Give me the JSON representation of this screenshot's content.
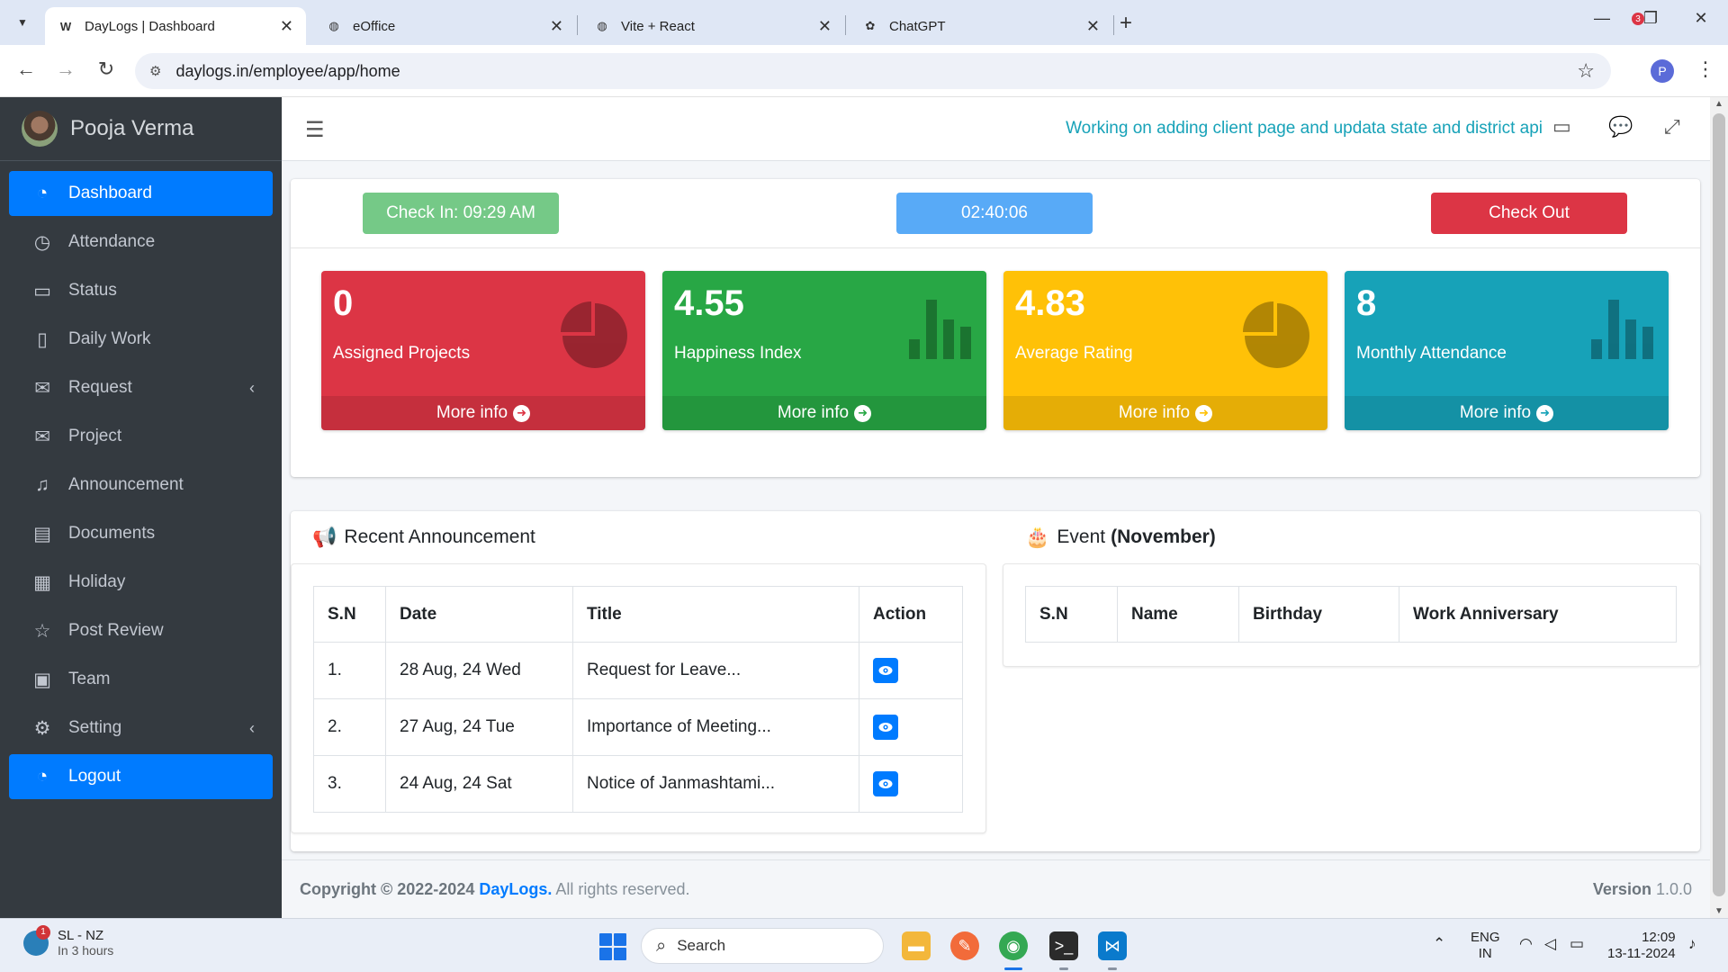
{
  "browser": {
    "tabs": [
      {
        "title": "DayLogs | Dashboard",
        "favicon": "W",
        "active": true
      },
      {
        "title": "eOffice",
        "favicon": "globe-icon",
        "active": false
      },
      {
        "title": "Vite + React",
        "favicon": "globe-icon",
        "active": false
      },
      {
        "title": "ChatGPT",
        "favicon": "chatgpt-icon",
        "active": false
      }
    ],
    "url": "daylogs.in/employee/app/home",
    "profile_initial": "P"
  },
  "sidebar": {
    "user_name": "Pooja Verma",
    "items": [
      {
        "label": "Dashboard",
        "icon": "tachometer-icon",
        "active": true
      },
      {
        "label": "Attendance",
        "icon": "clock-icon"
      },
      {
        "label": "Status",
        "icon": "laptop-icon"
      },
      {
        "label": "Daily Work",
        "icon": "clipboard-icon"
      },
      {
        "label": "Request",
        "icon": "envelope-icon",
        "has_submenu": true
      },
      {
        "label": "Project",
        "icon": "envelope-open-icon"
      },
      {
        "label": "Announcement",
        "icon": "bell-icon"
      },
      {
        "label": "Documents",
        "icon": "file-pdf-icon"
      },
      {
        "label": "Holiday",
        "icon": "calendar-icon"
      },
      {
        "label": "Post Review",
        "icon": "star-icon"
      },
      {
        "label": "Team",
        "icon": "id-card-icon"
      },
      {
        "label": "Setting",
        "icon": "cogs-icon",
        "has_submenu": true
      },
      {
        "label": "Logout",
        "icon": "tachometer-icon",
        "active": true
      }
    ]
  },
  "topnav": {
    "status_message": "Working on adding client page and updata state and district api",
    "notification_count": "3"
  },
  "attendance": {
    "check_in_label": "Check In: 09:29 AM",
    "timer": "02:40:06",
    "check_out_label": "Check Out"
  },
  "stats": [
    {
      "value": "0",
      "label": "Assigned Projects",
      "footer": "More info",
      "color": "#dc3545",
      "icon": "pie-chart-icon"
    },
    {
      "value": "4.55",
      "label": "Happiness Index",
      "footer": "More info",
      "color": "#28a745",
      "icon": "bar-chart-icon"
    },
    {
      "value": "4.83",
      "label": "Average Rating",
      "footer": "More info",
      "color": "#ffc107",
      "icon": "pie-chart-icon"
    },
    {
      "value": "8",
      "label": "Monthly Attendance",
      "footer": "More info",
      "color": "#17a2b8",
      "icon": "bar-chart-icon"
    }
  ],
  "announcements": {
    "title": "Recent Announcement",
    "columns": [
      "S.N",
      "Date",
      "Title",
      "Action"
    ],
    "rows": [
      {
        "sn": "1.",
        "date": "28 Aug, 24 Wed",
        "title": "Request for Leave..."
      },
      {
        "sn": "2.",
        "date": "27 Aug, 24 Tue",
        "title": "Importance of Meeting..."
      },
      {
        "sn": "3.",
        "date": "24 Aug, 24 Sat",
        "title": "Notice of Janmashtami..."
      }
    ]
  },
  "events": {
    "title": "Event",
    "month": "(November)",
    "columns": [
      "S.N",
      "Name",
      "Birthday",
      "Work Anniversary"
    ]
  },
  "footer": {
    "copyright_prefix": "Copyright © 2022-2024",
    "brand": "DayLogs.",
    "rights": "All rights reserved.",
    "version_label": "Version",
    "version_number": "1.0.0"
  },
  "taskbar": {
    "weather_location": "SL - NZ",
    "weather_sub": "In 3 hours",
    "weather_badge": "1",
    "search_placeholder": "Search",
    "lang_top": "ENG",
    "lang_bottom": "IN",
    "time": "12:09",
    "date": "13-11-2024"
  }
}
